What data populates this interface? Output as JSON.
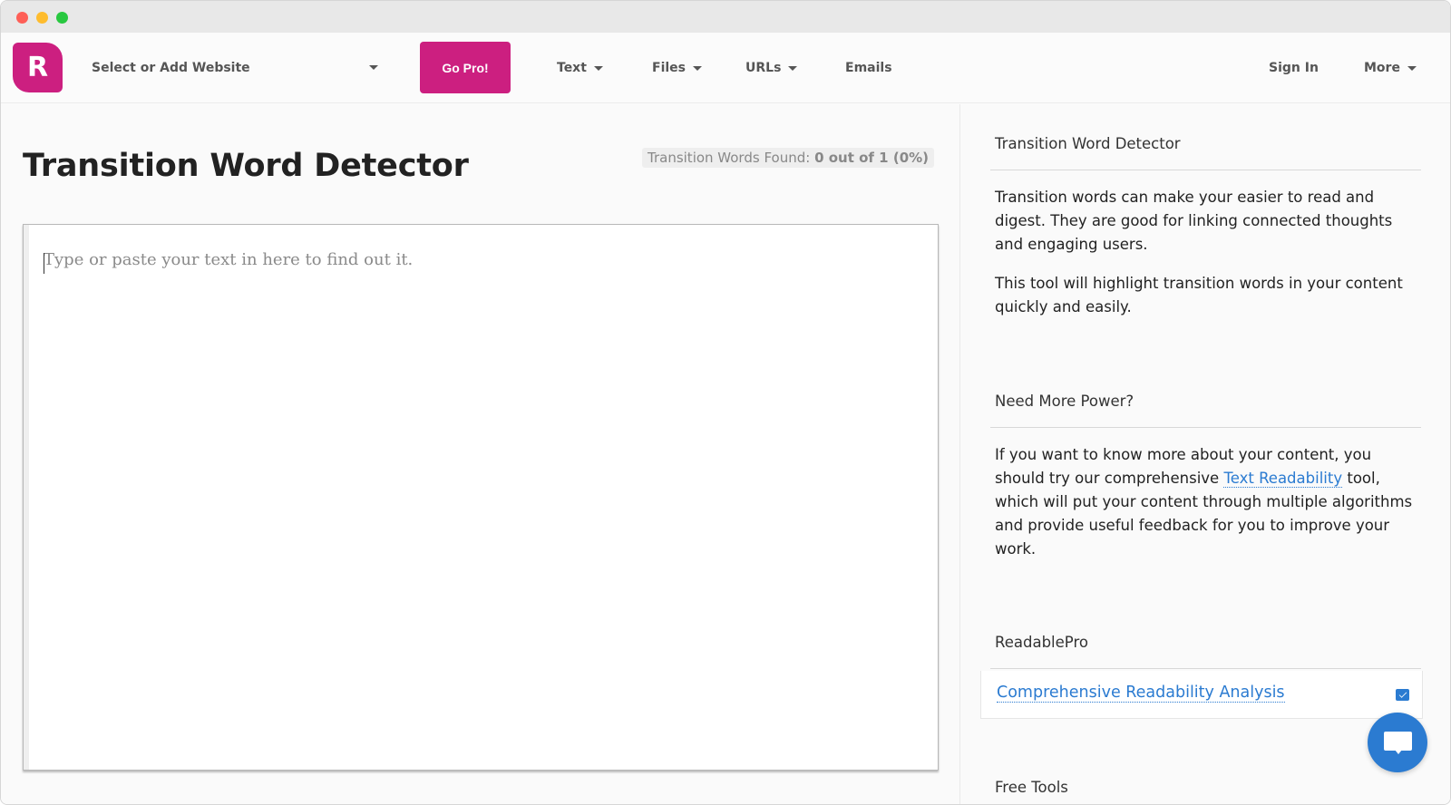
{
  "navbar": {
    "logo_letter": "R",
    "site_select_label": "Select or Add Website",
    "go_pro_label": "Go Pro!",
    "items": [
      {
        "label": "Text",
        "has_dropdown": true
      },
      {
        "label": "Files",
        "has_dropdown": true
      },
      {
        "label": "URLs",
        "has_dropdown": true
      },
      {
        "label": "Emails",
        "has_dropdown": false
      }
    ],
    "sign_in_label": "Sign In",
    "more_label": "More"
  },
  "main": {
    "title": "Transition Word Detector",
    "stats": {
      "label": "Transition Words Found:",
      "value": "0 out of 1 (0%)"
    },
    "editor": {
      "placeholder": "Type or paste your text in here to find out it.",
      "value": ""
    }
  },
  "sidebar": {
    "section1": {
      "heading": "Transition Word Detector",
      "para1": "Transition words can make your easier to read and digest. They are good for linking connected thoughts and engaging users.",
      "para2": "This tool will highlight transition words in your content quickly and easily."
    },
    "section2": {
      "heading": "Need More Power?",
      "para_before": "If you want to know more about your content, you should try our comprehensive ",
      "link_label": "Text Readability",
      "para_after": " tool, which will put your content through multiple algorithms and provide useful feedback for you to improve your work."
    },
    "section3": {
      "heading": "ReadablePro",
      "card_link_label": "Comprehensive Readability Analysis",
      "card_icon": "mail-icon"
    },
    "section4": {
      "heading": "Free Tools"
    }
  },
  "colors": {
    "brand": "#cc1f80",
    "link": "#2b7bd1",
    "chat_button": "#2b7bd1"
  }
}
